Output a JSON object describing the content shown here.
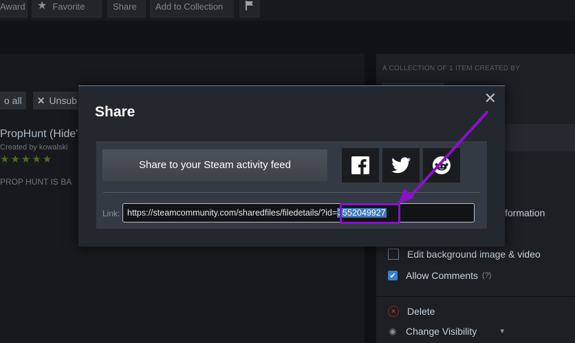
{
  "topbar": {
    "buttons": [
      {
        "label": "Award",
        "icon": "award-icon"
      },
      {
        "label": "Favorite",
        "icon": "star-icon"
      },
      {
        "label": "Share"
      },
      {
        "label": "Add to Collection"
      },
      {
        "icon": "flag-icon"
      }
    ]
  },
  "left": {
    "subscribe_all_partial": "o all",
    "unsubscribe_partial": "Unsub",
    "item_title_partial": "PropHunt (Hide'",
    "item_author_partial": "Created by kowalski",
    "rating_stars": "★★★★★",
    "item_desc_partial": "PROP HUNT IS BA"
  },
  "right_column": {
    "collection_title": "A COLLECTION OF 1 ITEM CREATED BY",
    "partial_text": "formation",
    "actions": {
      "edit_background": "Edit background image & video",
      "allow_comments": "Allow Comments",
      "allow_comments_help": "(?)",
      "delete": "Delete",
      "change_visibility": "Change Visibility"
    }
  },
  "modal": {
    "title": "Share",
    "close_glyph": "✕",
    "share_feed_label": "Share to your Steam activity feed",
    "social_icons": [
      "facebook-icon",
      "twitter-icon",
      "reddit-icon"
    ],
    "link_label": "Link:",
    "link_prefix": "https://steamcommunity.com/sharedfiles/filedetails/?id=",
    "link_selected": "3552049927"
  },
  "colors": {
    "annotation": "#8a11c9",
    "selection": "#3f79b8",
    "modal_accent": "#3a90c8"
  }
}
